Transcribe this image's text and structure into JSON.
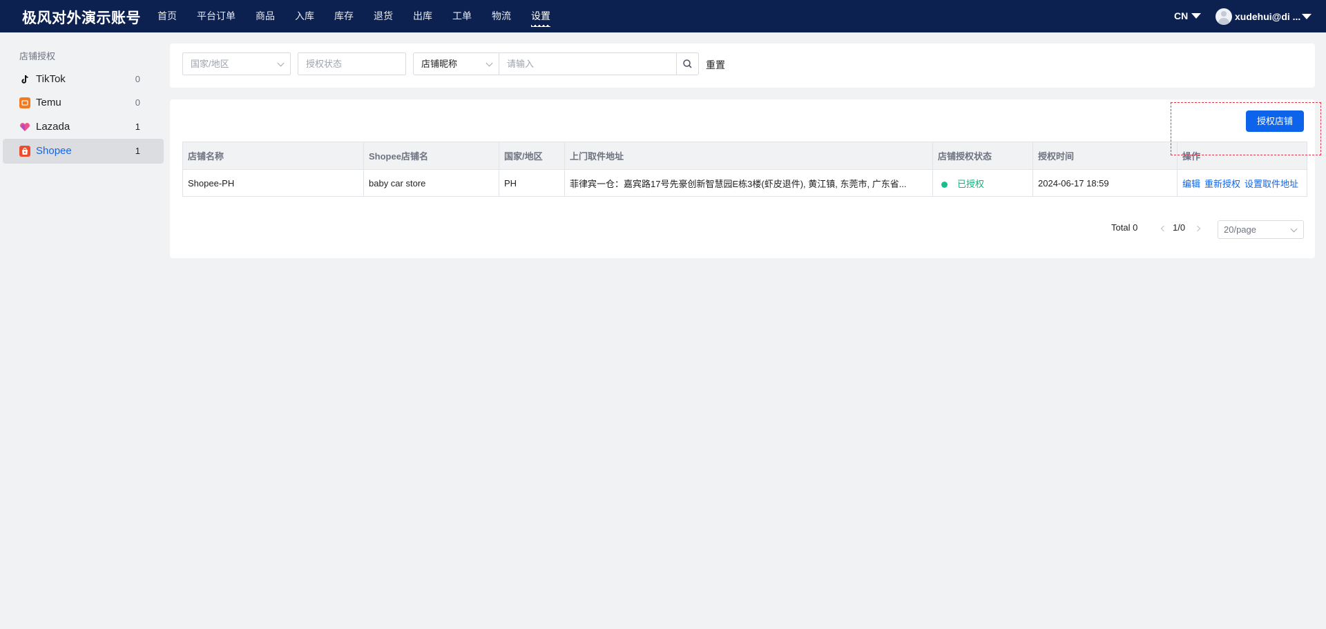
{
  "brand": "极风对外演示账号",
  "nav": [
    "首页",
    "平台订单",
    "商品",
    "入库",
    "库存",
    "退货",
    "出库",
    "工单",
    "物流",
    "设置"
  ],
  "nav_active": "设置",
  "lang": "CN",
  "user": "xudehui@di ...",
  "sidebar": {
    "title": "店铺授权",
    "items": [
      {
        "label": "TikTok",
        "count": "0",
        "icon": "tiktok-icon",
        "color": "#111111"
      },
      {
        "label": "Temu",
        "count": "0",
        "icon": "temu-icon",
        "color": "#f47a20"
      },
      {
        "label": "Lazada",
        "count": "1",
        "icon": "lazada-icon",
        "color": "#f0528c"
      },
      {
        "label": "Shopee",
        "count": "1",
        "icon": "shopee-icon",
        "color": "#ee4d2d"
      }
    ],
    "active": "Shopee"
  },
  "filters": {
    "country_placeholder": "国家/地区",
    "status_placeholder": "授权状态",
    "field_select": "店铺昵称",
    "search_placeholder": "请输入",
    "reset": "重置"
  },
  "auth_button": "授权店铺",
  "table": {
    "headers": [
      "店铺名称",
      "Shopee店铺名",
      "国家/地区",
      "上门取件地址",
      "店铺授权状态",
      "授权时间",
      "操作"
    ],
    "rows": [
      {
        "name": "Shopee-PH",
        "shop_name": "baby car store",
        "country": "PH",
        "address": "菲律宾一仓：嘉宾路17号先豪创新智慧园E栋3楼(虾皮退件), 黄江镇, 东莞市, 广东省...",
        "status": "已授权",
        "time": "2024-06-17 18:59",
        "actions": [
          "编辑",
          "重新授权",
          "设置取件地址"
        ]
      }
    ]
  },
  "pagination": {
    "total": "Total 0",
    "page": "1/0",
    "page_size": "20/page"
  },
  "colors": {
    "header_bg": "#0c2150",
    "primary": "#0d63ea",
    "success": "#16bf8b",
    "highlight_dash": "#e0344b"
  }
}
